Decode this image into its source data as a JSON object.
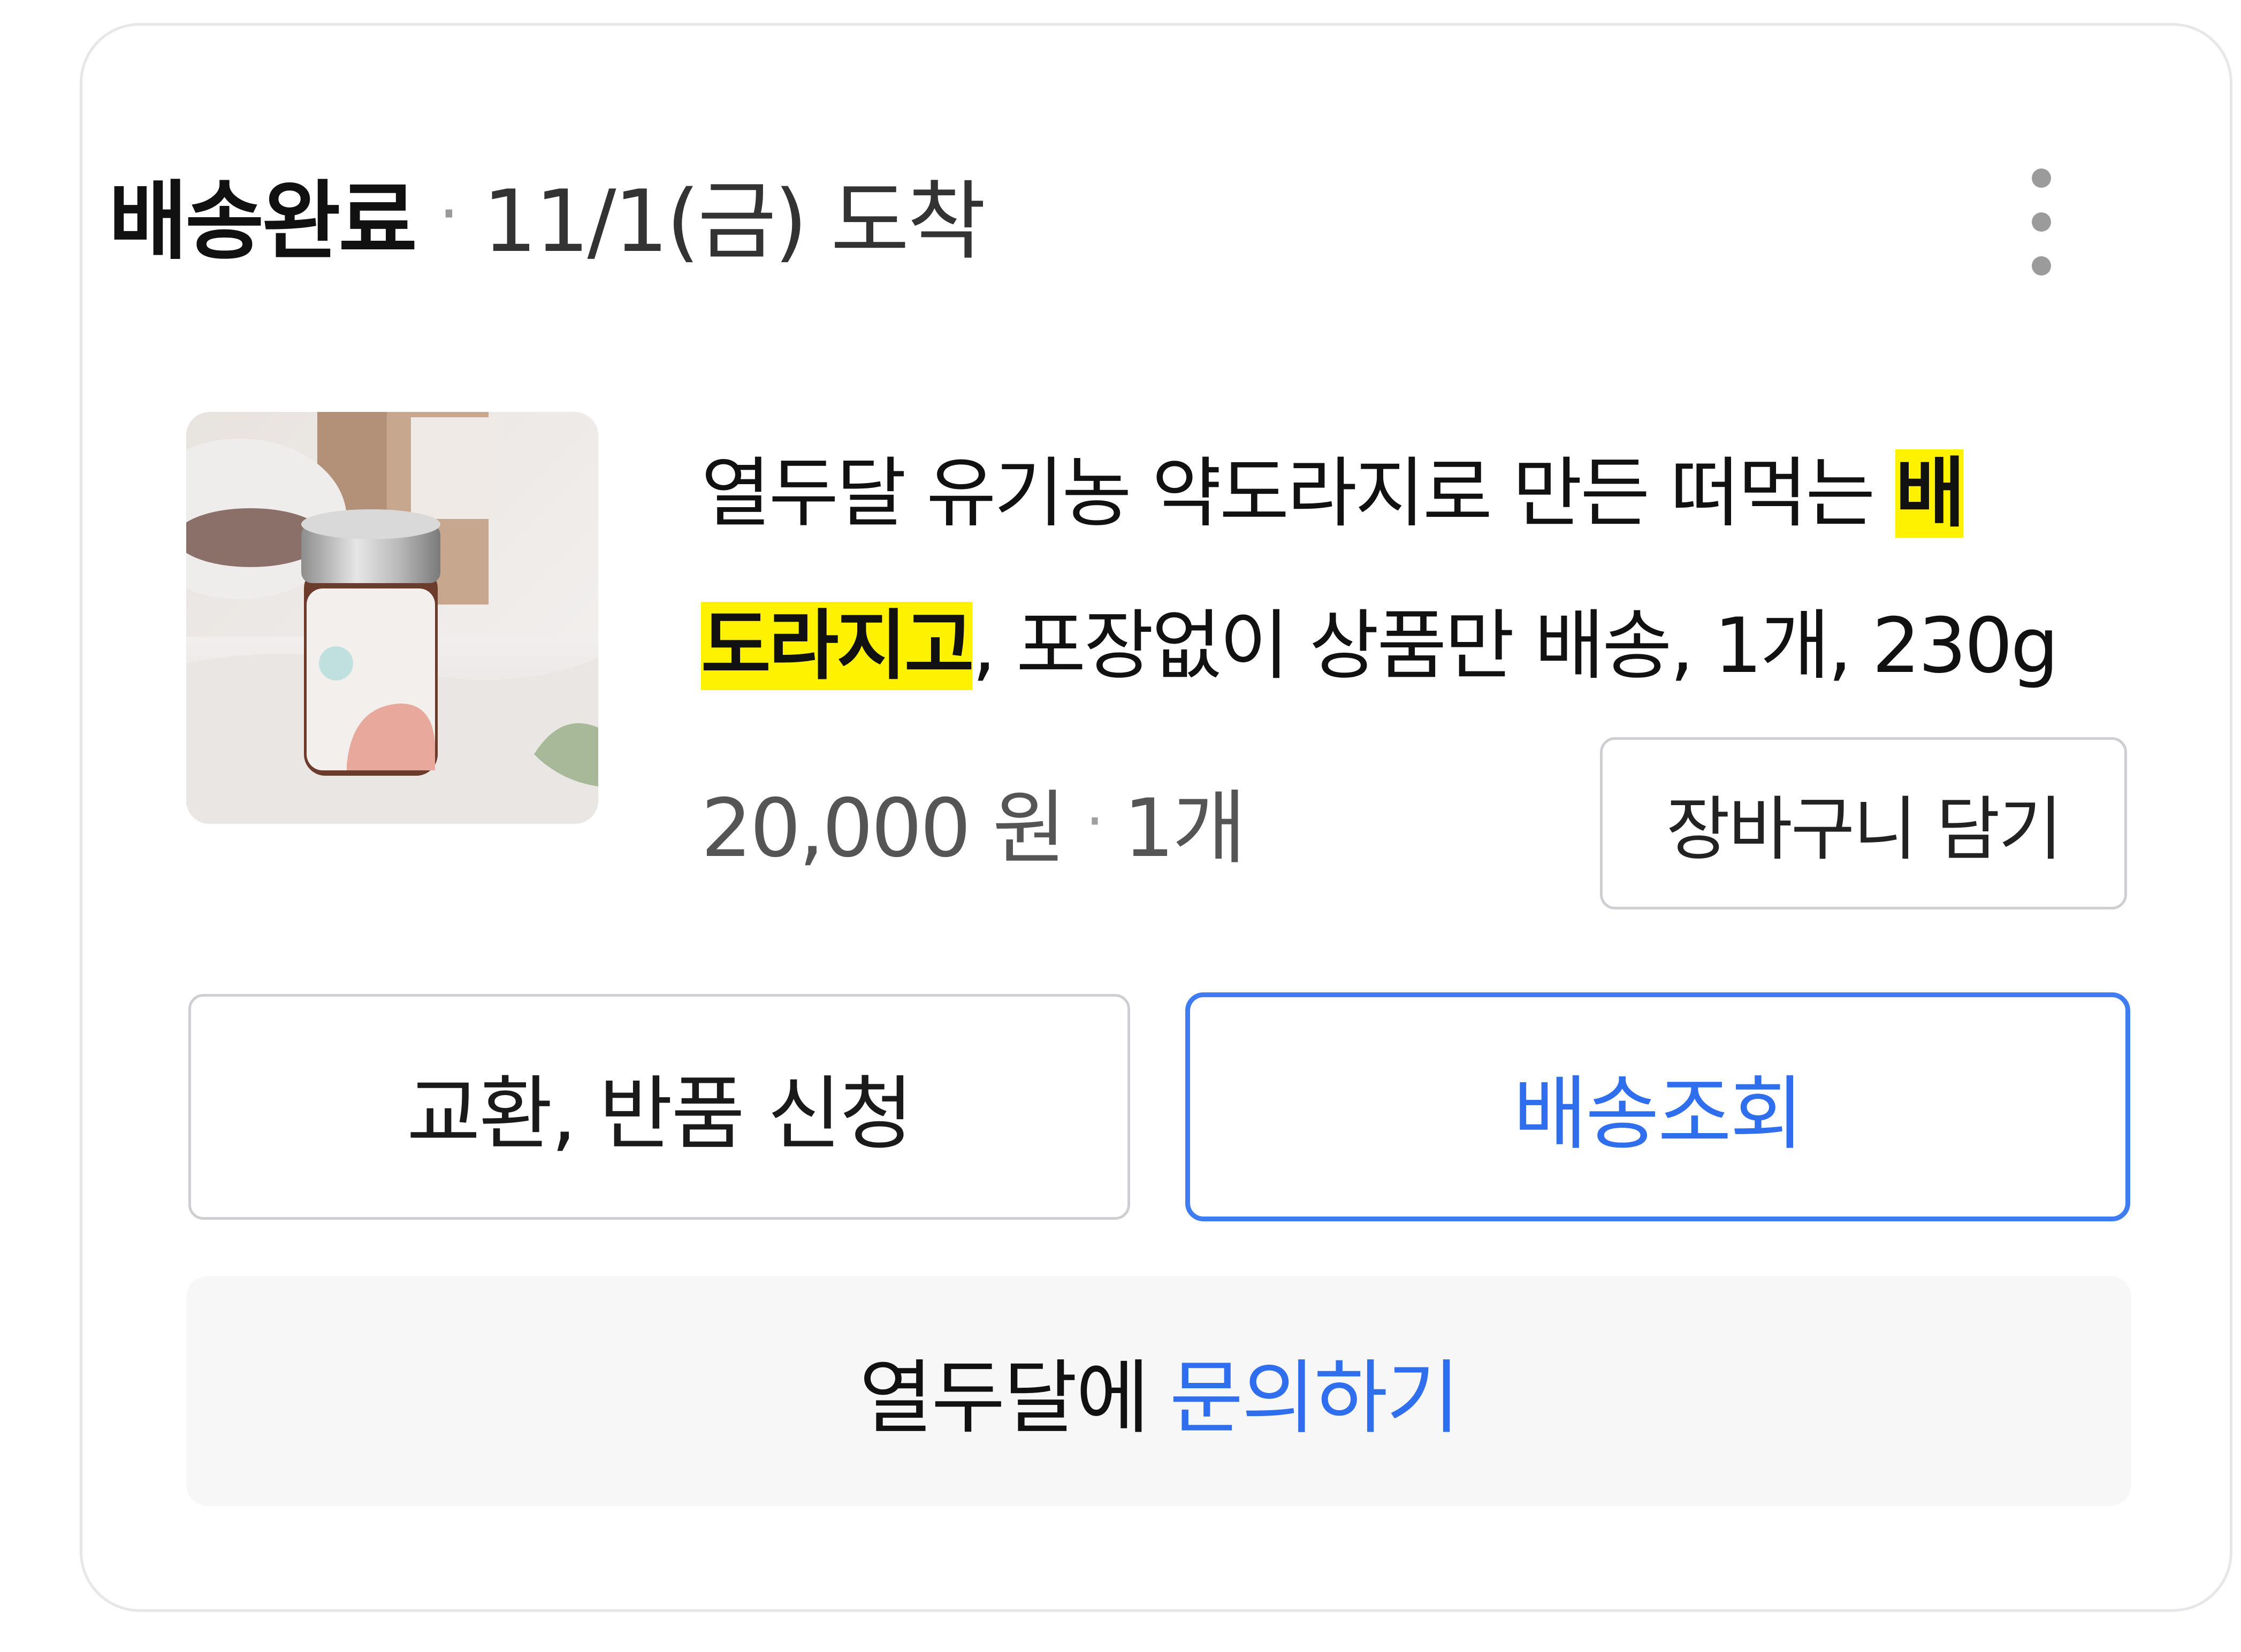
{
  "order": {
    "status_title": "배송완료",
    "separator": "·",
    "arrival_text": "11/1(금) 도착"
  },
  "menu": {
    "icon": "more-vertical-icon"
  },
  "product": {
    "image_alt": "product-jar-photo",
    "title_before": "열두달 유기농 약도라지로 만든 떠먹는 ",
    "title_highlight_1": "배",
    "title_highlight_2": "도라지고",
    "title_after": ", 포장없이 상품만 배송, 1개, 230g",
    "highlight_color": "#fff200",
    "price": "20,000 원",
    "separator": "·",
    "quantity": "1개"
  },
  "actions": {
    "cart_label": "장바구니 담기",
    "return_label": "교환, 반품 신청",
    "track_label": "배송조회",
    "inquiry_prefix": "열두달에",
    "inquiry_link": "문의하기"
  },
  "colors": {
    "accent": "#2f6fee",
    "border": "#cfcfd3",
    "muted": "#9b9b9b"
  }
}
